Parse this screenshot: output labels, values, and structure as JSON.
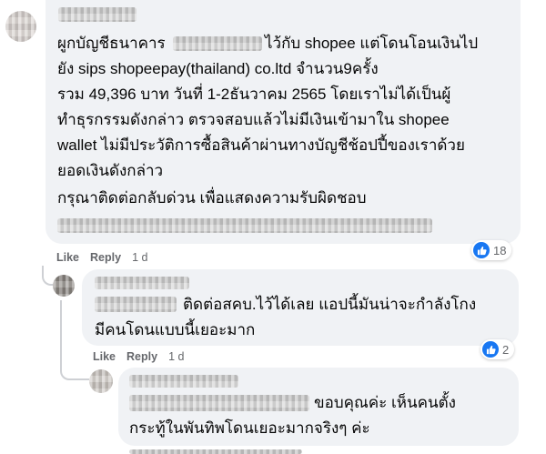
{
  "comment1": {
    "lines": [
      "ผูกบัญชีธนาคาร",
      "ไว้กับ shopee แต่โดนโอนเงินไป",
      "ยัง sips shopeepay(thailand) co.ltd จำนวน9ครั้ง",
      "รวม 49,396 บาท วันที่ 1-2ธันวาคม 2565 โดยเราไม่ได้เป็นผู้",
      "ทำธุรกรรมดังกล่าว ตรวจสอบแล้วไม่มีเงินเข้ามาใน shopee",
      "wallet ไม่มีประวัติการซื้อสินค้าผ่านทางบัญชีช้อปปี้ของเราด้วย",
      "ยอดเงินดังกล่าว",
      "กรุณาติดต่อกลับด่วน เพื่อแสดงความรับผิดชอบ"
    ],
    "like": "Like",
    "reply": "Reply",
    "time": "1 d",
    "reaction_count": "18"
  },
  "comment2": {
    "lines": [
      "ติดต่อสคบ.ไว้ได้เลย แอปนี้มันน่าจะกำลังโกง",
      "มีคนโดนแบบนี้เยอะมาก"
    ],
    "like": "Like",
    "reply": "Reply",
    "time": "1 d",
    "reaction_count": "2"
  },
  "comment3": {
    "lines": [
      "ขอบคุณค่ะ เห็นคนตั้ง",
      "กระทู้ในพันทิพโดนเยอะมากจริงๆ ค่ะ"
    ]
  },
  "colors": {
    "bubble": "#f0f2f5",
    "secondary_text": "#65676b",
    "like_blue": "#1877f2"
  },
  "icons": [
    "like-icon"
  ]
}
